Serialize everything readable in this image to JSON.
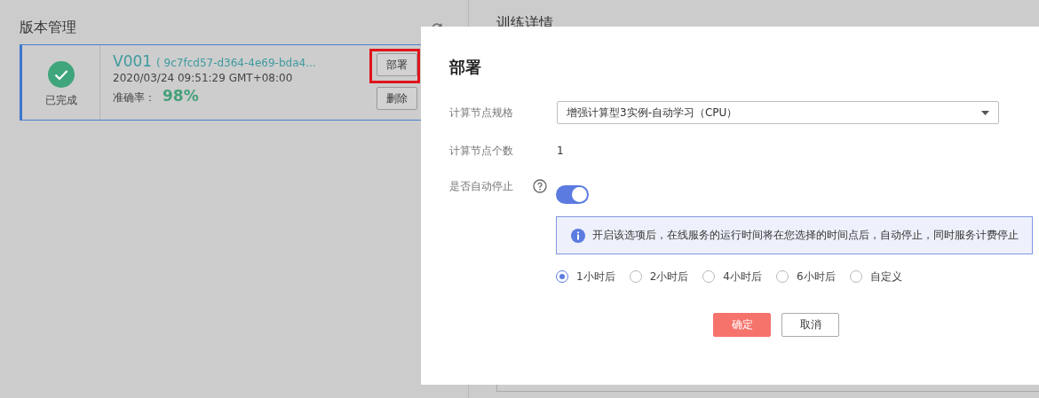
{
  "version_panel": {
    "title": "版本管理",
    "versions": [
      {
        "status": "已完成",
        "kind": "done",
        "selected": true,
        "version": "V001",
        "id": "( 9c7fcd57-d364-4e69-bda4...",
        "time": "2020/03/24 09:51:29 GMT+08:00",
        "accuracy_label": "准确率：",
        "accuracy": "98%",
        "buttons": [
          {
            "label": "部署",
            "highlighted": true
          },
          {
            "label": "删除",
            "highlighted": false
          }
        ]
      }
    ]
  },
  "detail_panel": {
    "title": "训练详情"
  },
  "dialog": {
    "title": "部署",
    "fields": [
      {
        "kind": "select",
        "label": "计算节点规格",
        "value": "增强计算型3实例-自动学习（CPU）"
      },
      {
        "kind": "text",
        "label": "计算节点个数",
        "value": "1"
      },
      {
        "kind": "toggle",
        "label": "是否自动停止",
        "help": true,
        "on": true,
        "info": "开启该选项后，在线服务的运行时间将在您选择的时间点后，自动停止，同时服务计费停止",
        "options": [
          {
            "label": "1小时后",
            "selected": true
          },
          {
            "label": "2小时后",
            "selected": false
          },
          {
            "label": "4小时后",
            "selected": false
          },
          {
            "label": "6小时后",
            "selected": false
          },
          {
            "label": "自定义",
            "selected": false
          }
        ]
      }
    ],
    "buttons": [
      {
        "label": "确定",
        "kind": "primary"
      },
      {
        "label": "取消",
        "kind": "secondary"
      }
    ]
  }
}
